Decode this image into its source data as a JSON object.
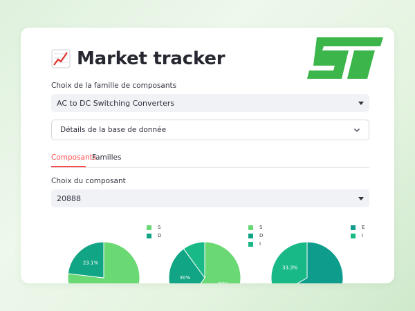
{
  "header": {
    "title": "Market tracker",
    "title_icon": "chart-increasing-icon",
    "logo": "ST"
  },
  "family_select": {
    "label": "Choix de la famille de composants",
    "value": "AC to DC Switching Converters"
  },
  "expander": {
    "label": "Détails de la base de donnée"
  },
  "tabs": [
    {
      "label": "Composants",
      "active": true
    },
    {
      "label": "Familles",
      "active": false
    }
  ],
  "component_select": {
    "label": "Choix du composant",
    "value": "20888"
  },
  "colors": {
    "accent": "#ff4b4b",
    "logo_green": "#3cb54a",
    "light_green": "#6ad873",
    "teal": "#11a585",
    "dark_teal": "#0e9c8c",
    "mid_green": "#19b987"
  },
  "pies": [
    {
      "legend": [
        {
          "label": "S",
          "color": "#6ad873"
        },
        {
          "label": "D",
          "color": "#11a585"
        }
      ],
      "slices": [
        {
          "value": 76.9,
          "label": "",
          "color": "#6ad873"
        },
        {
          "value": 23.1,
          "label": "23.1%",
          "color": "#11a585"
        }
      ]
    },
    {
      "legend": [
        {
          "label": "S",
          "color": "#6ad873"
        },
        {
          "label": "D",
          "color": "#11a585"
        },
        {
          "label": "I",
          "color": "#19b987"
        }
      ],
      "slices": [
        {
          "value": 60,
          "label": "60%",
          "color": "#6ad873"
        },
        {
          "value": 30,
          "label": "30%",
          "color": "#11a585"
        },
        {
          "value": 10,
          "label": "",
          "color": "#19b987"
        }
      ]
    },
    {
      "legend": [
        {
          "label": "E",
          "color": "#0e9c8c"
        },
        {
          "label": "I",
          "color": "#19b987"
        }
      ],
      "slices": [
        {
          "value": 66.7,
          "label": "",
          "color": "#0e9c8c"
        },
        {
          "value": 33.3,
          "label": "33.3%",
          "color": "#19b987"
        }
      ]
    }
  ]
}
